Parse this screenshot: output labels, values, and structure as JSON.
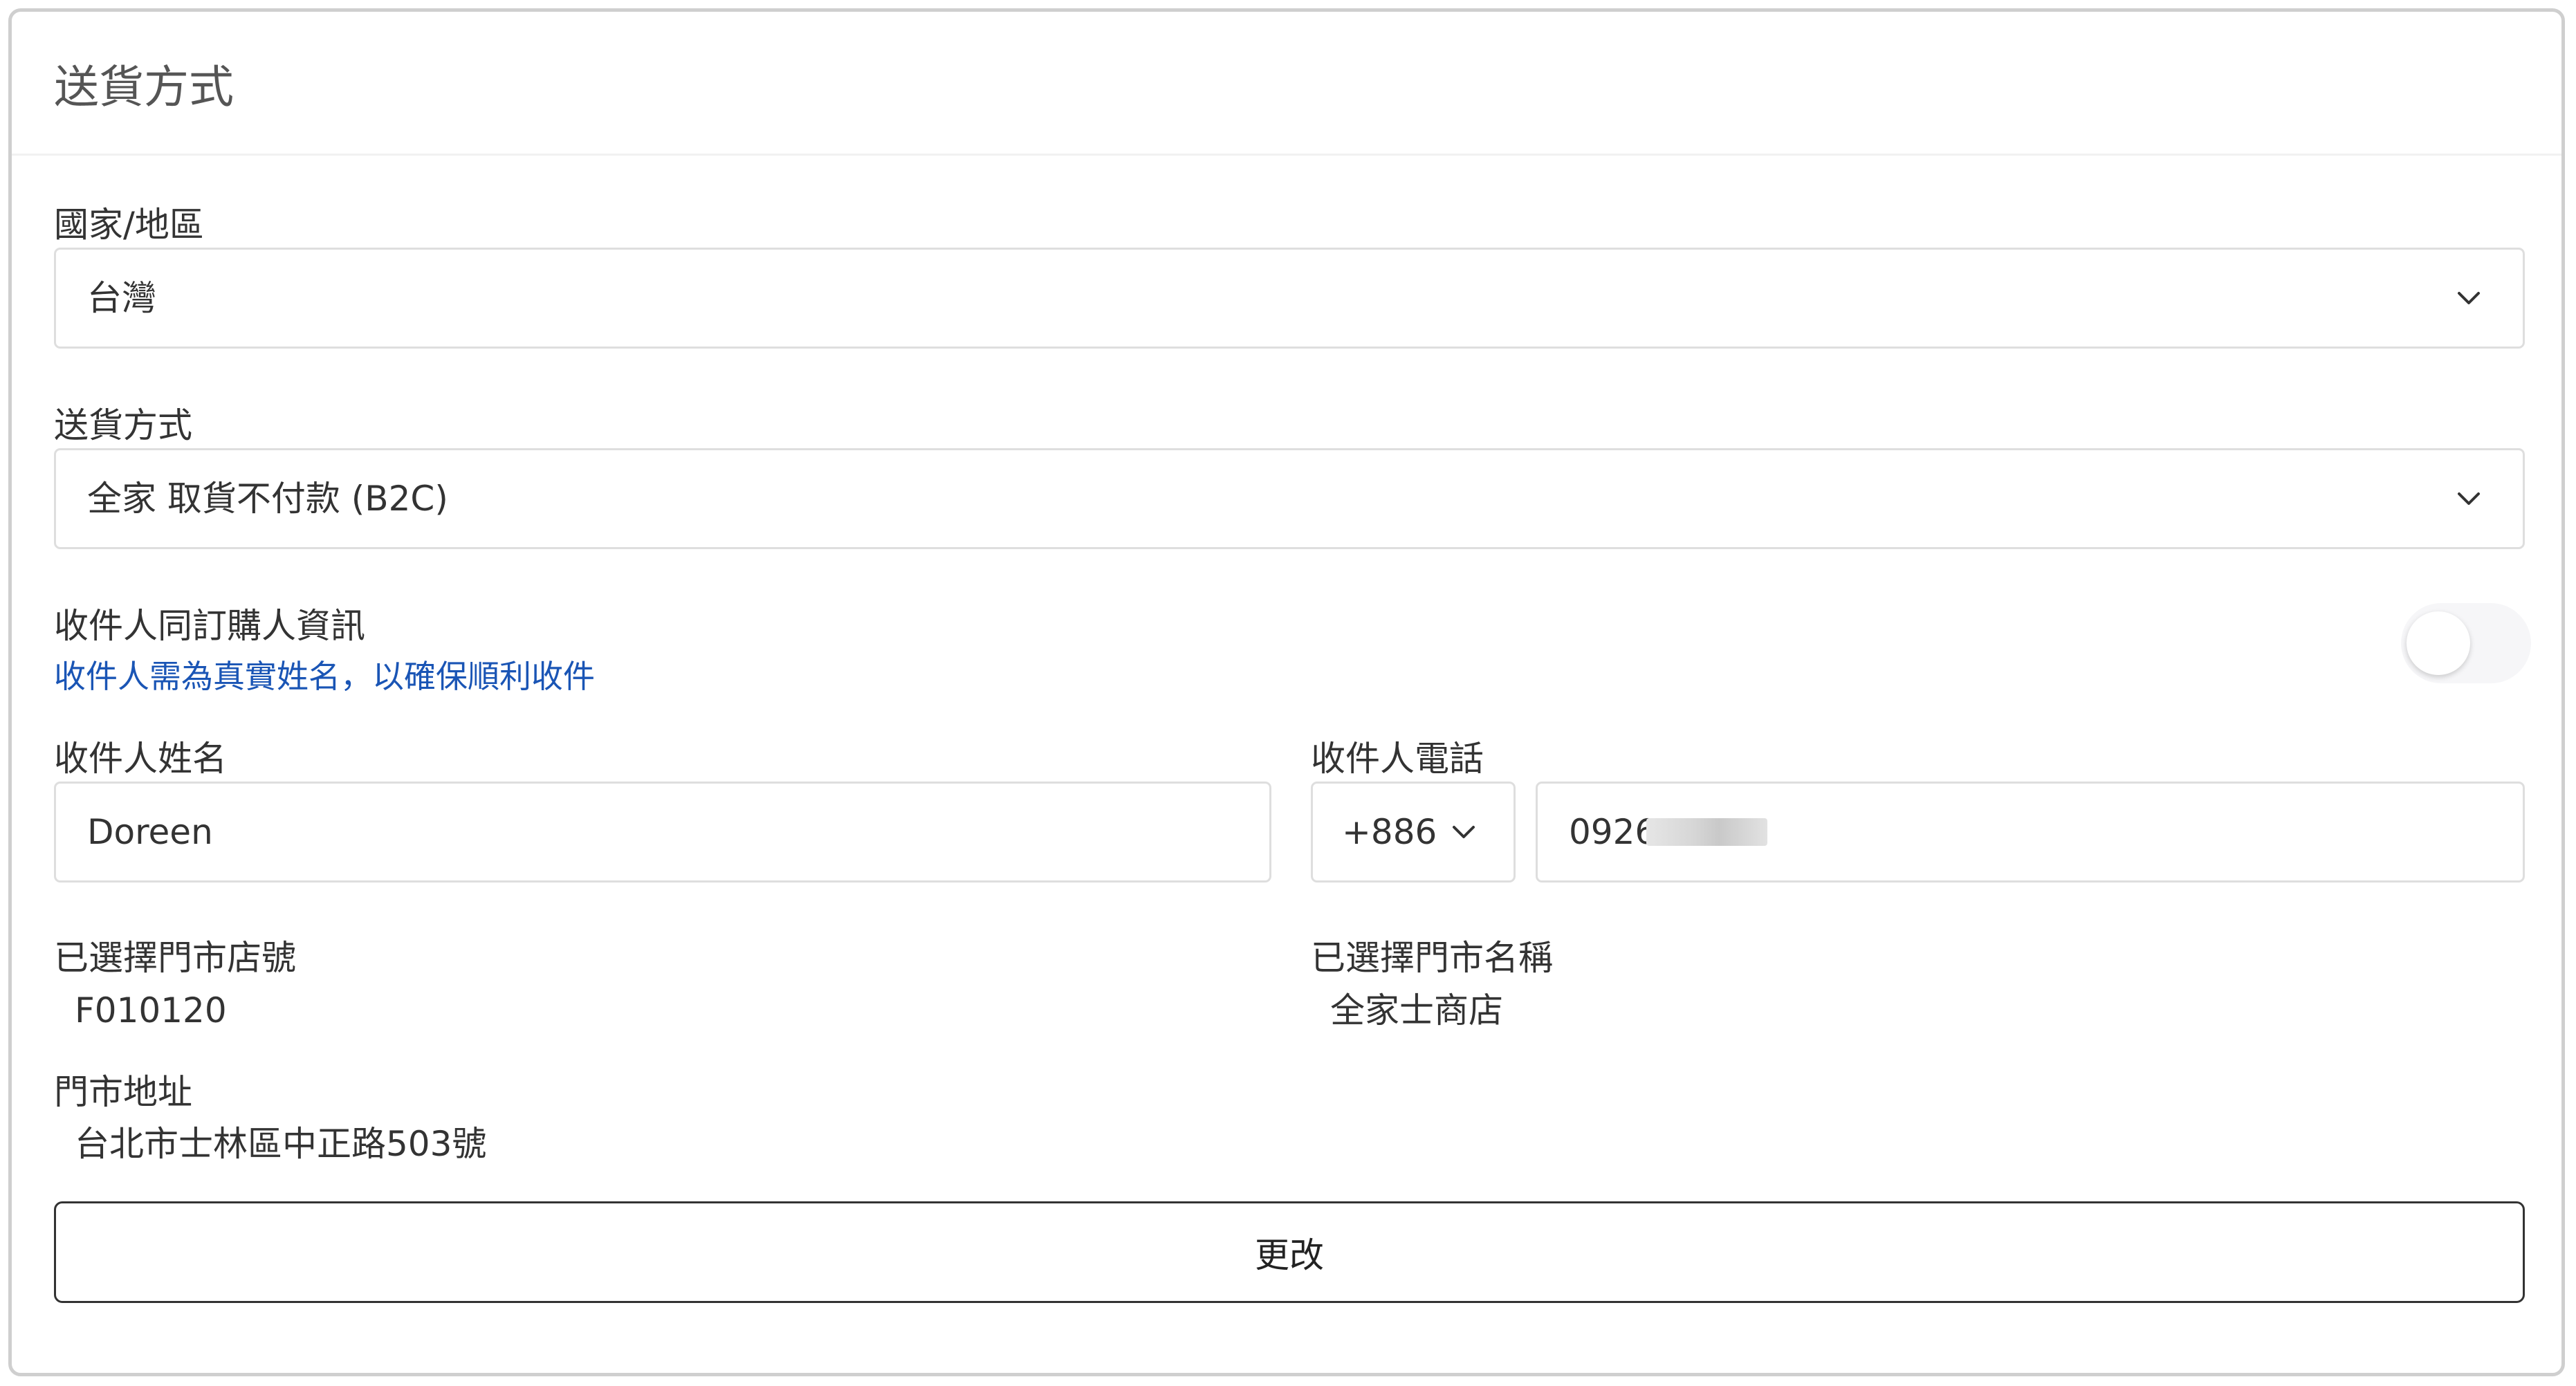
{
  "card": {
    "title": "送貨方式"
  },
  "country": {
    "label": "國家/地區",
    "value": "台灣"
  },
  "shipping": {
    "label": "送貨方式",
    "value": "全家 取貨不付款 (B2C)"
  },
  "same_as_buyer": {
    "label": "收件人同訂購人資訊",
    "hint": "收件人需為真實姓名，以確保順利收件",
    "enabled": false
  },
  "recipient_name": {
    "label": "收件人姓名",
    "value": "Doreen"
  },
  "recipient_phone": {
    "label": "收件人電話",
    "country_code": "+886",
    "number": "0926"
  },
  "store_id": {
    "label": "已選擇門市店號",
    "value": "F010120"
  },
  "store_name": {
    "label": "已選擇門市名稱",
    "value": "全家士商店"
  },
  "store_address": {
    "label": "門市地址",
    "value": "台北市士林區中正路503號"
  },
  "actions": {
    "change_label": "更改"
  },
  "colors": {
    "hint_blue": "#1a55b5",
    "border": "#dedede",
    "text": "#333333"
  }
}
